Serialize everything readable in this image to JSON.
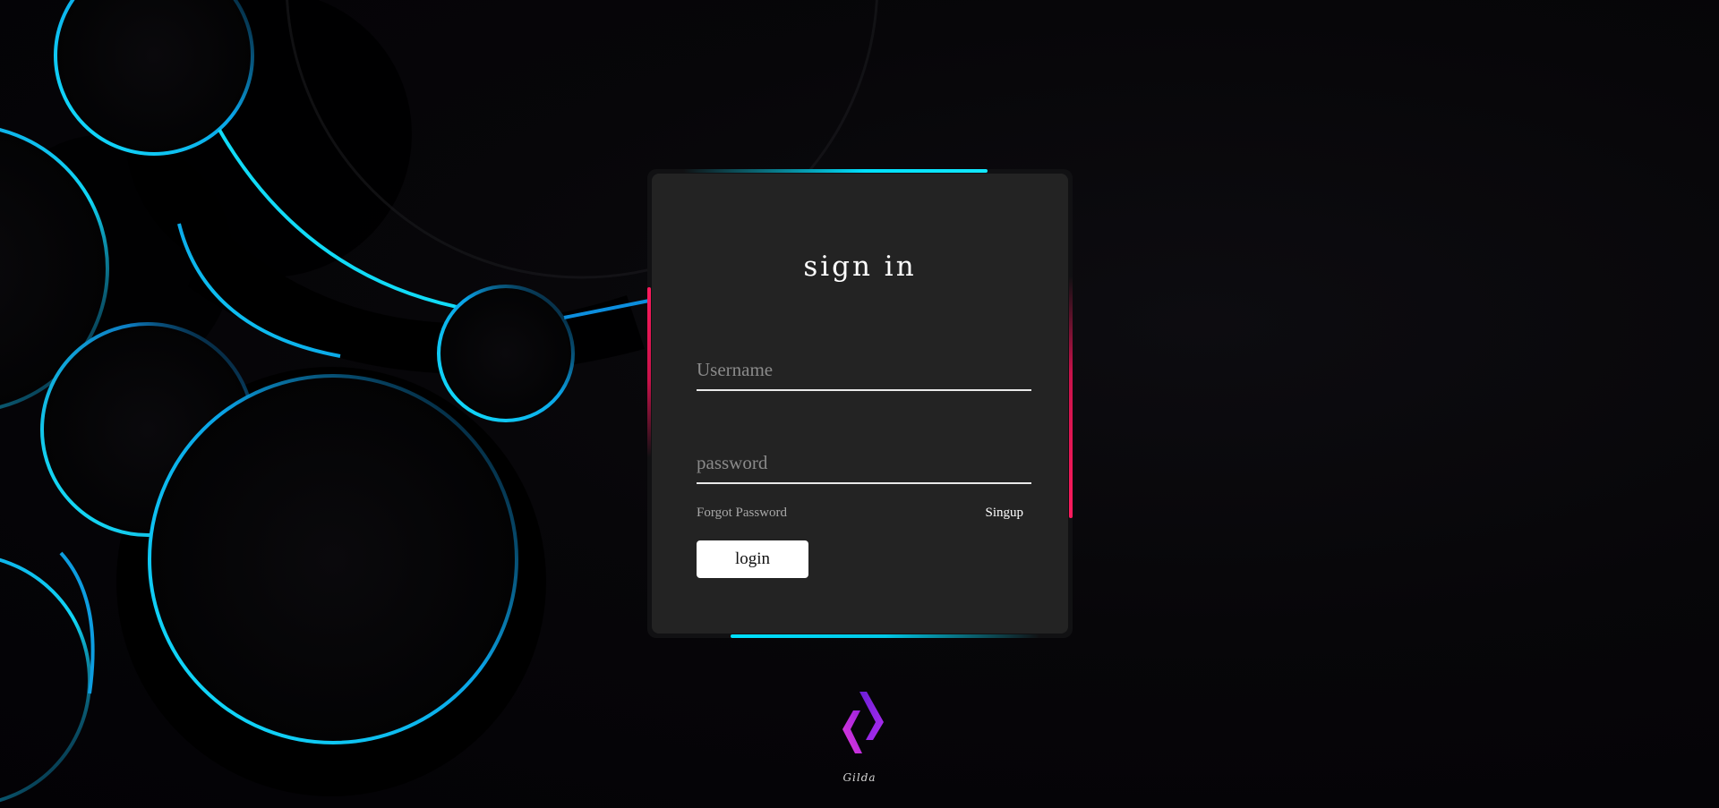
{
  "page": {
    "background_color": "#050407",
    "accent_cyan": "#00e1ff",
    "accent_pink": "#e6185a",
    "card_color": "#232323"
  },
  "login": {
    "title": "sign in",
    "username_placeholder": "Username",
    "password_placeholder": "password",
    "forgot_label": "Forgot Password",
    "signup_label": "Singup",
    "login_label": "login"
  },
  "brand": {
    "name": "Gilda",
    "logo_icon": "chevrons-logo-icon"
  }
}
